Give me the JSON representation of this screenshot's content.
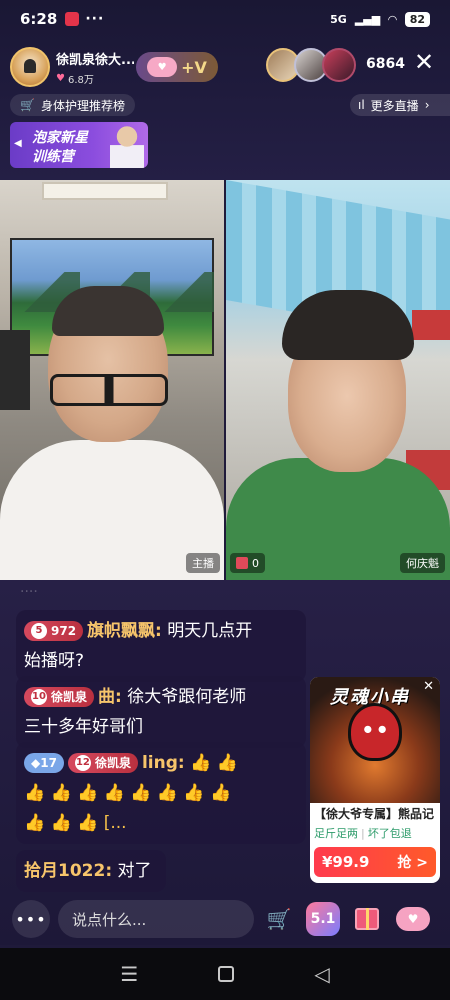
{
  "status": {
    "time": "6:28",
    "network": "5G",
    "battery": "82"
  },
  "host": {
    "name": "徐凯泉徐大...",
    "likes": "6.8万",
    "fan_icon": "cloud-heart-icon",
    "fan_plus": "+V"
  },
  "viewers": {
    "count": "6864"
  },
  "rank": {
    "label": "身体护理推荐榜",
    "more_live": "更多直播"
  },
  "banner": {
    "line1": "泡家新星",
    "line2": "训练营"
  },
  "video": {
    "host_tag": "主播",
    "gift_count": "0",
    "guest_name": "何庆魁"
  },
  "chat": {
    "messages": [
      {
        "badge": "972",
        "user": "旗帜飘飘:",
        "text_line1": " 明天几点开",
        "text_line2": "始播呀?"
      },
      {
        "badge_level": "10",
        "badge_name": "徐凯泉",
        "user": "曲:",
        "text_line1": " 徐大爷跟何老师",
        "text_line2": "三十多年好哥们"
      },
      {
        "badge_a": "17",
        "badge_level": "12",
        "badge_name": "徐凯泉",
        "user": "ling:",
        "thumbs_line1": " 👍 👍",
        "thumbs_line2": "👍 👍 👍 👍 👍 👍 👍 👍",
        "thumbs_line3": "👍 👍 👍 [..."
      },
      {
        "user": "拾月1022:",
        "text": " 对了"
      }
    ]
  },
  "product": {
    "image_title": "灵魂小串",
    "name": "【徐大爷专属】熊品记",
    "tag1": "足斤足两",
    "tag2": "坏了包退",
    "price": "¥99.9",
    "grab": "抢 >"
  },
  "bottom": {
    "input_placeholder": "说点什么...",
    "e51_label": "5.1"
  },
  "colors": {
    "accent_gold": "#f7c56b",
    "badge_red": "#d6495e",
    "buy_red": "#ff3b4d"
  }
}
